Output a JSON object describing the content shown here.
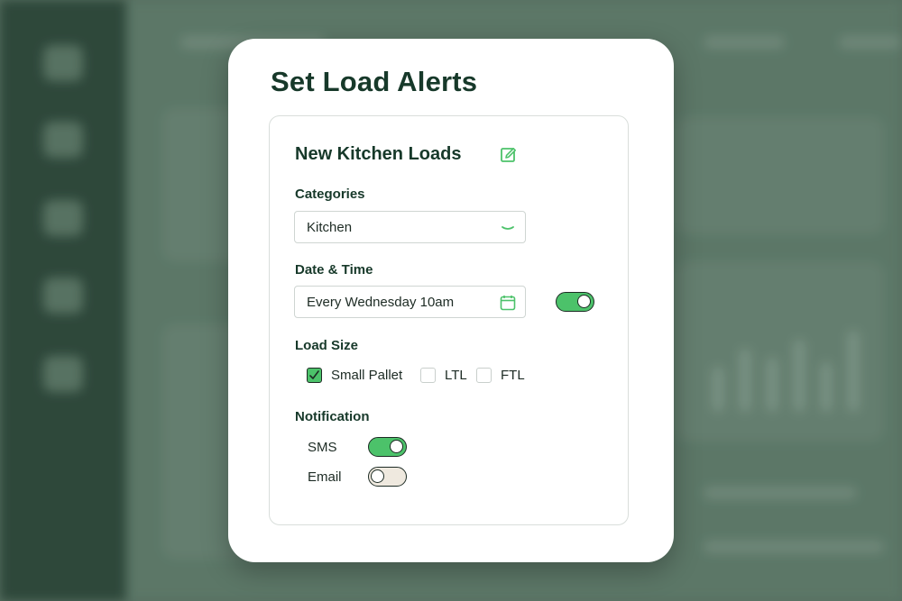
{
  "modal": {
    "title": "Set Load Alerts"
  },
  "alert": {
    "name": "New Kitchen Loads",
    "edit_icon": "edit-icon"
  },
  "categories": {
    "label": "Categories",
    "value": "Kitchen",
    "icon": "chevron-down-icon"
  },
  "datetime": {
    "label": "Date & Time",
    "value": "Every Wednesday 10am",
    "icon": "calendar-icon",
    "enabled": true
  },
  "load_size": {
    "label": "Load Size",
    "options": [
      {
        "label": "Small Pallet",
        "checked": true
      },
      {
        "label": "LTL",
        "checked": false
      },
      {
        "label": "FTL",
        "checked": false
      }
    ]
  },
  "notification": {
    "label": "Notification",
    "channels": [
      {
        "label": "SMS",
        "enabled": true
      },
      {
        "label": "Email",
        "enabled": false
      }
    ]
  },
  "colors": {
    "accent": "#4cc26a",
    "title": "#17392a",
    "toggle_off": "#efe9df"
  }
}
